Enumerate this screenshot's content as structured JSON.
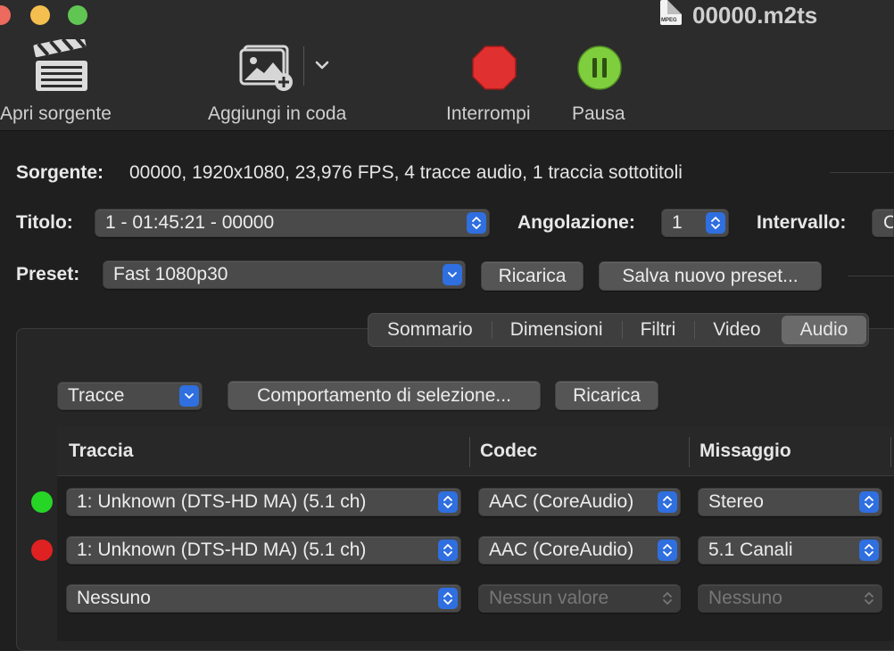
{
  "window": {
    "title": "00000.m2ts",
    "doc_icon_label": "MPEG"
  },
  "toolbar": {
    "open_source": "Apri sorgente",
    "add_queue": "Aggiungi in coda",
    "stop": "Interrompi",
    "pause": "Pausa"
  },
  "source": {
    "label": "Sorgente:",
    "value": "00000, 1920x1080, 23,976 FPS, 4 tracce audio, 1 traccia sottotitoli"
  },
  "title_row": {
    "label": "Titolo:",
    "value": "1 - 01:45:21 - 00000",
    "angle_label": "Angolazione:",
    "angle_value": "1",
    "range_label": "Intervallo:",
    "range_value": "C"
  },
  "preset_row": {
    "label": "Preset:",
    "value": "Fast 1080p30",
    "reload": "Ricarica",
    "save_new": "Salva nuovo preset..."
  },
  "tabs": [
    {
      "label": "Sommario",
      "selected": false
    },
    {
      "label": "Dimensioni",
      "selected": false
    },
    {
      "label": "Filtri",
      "selected": false
    },
    {
      "label": "Video",
      "selected": false
    },
    {
      "label": "Audio",
      "selected": true
    }
  ],
  "audio": {
    "tracks_popup": "Tracce",
    "selection_behavior": "Comportamento di selezione...",
    "reload": "Ricarica",
    "columns": [
      "Traccia",
      "Codec",
      "Missaggio"
    ],
    "rows": [
      {
        "status_color": "#27d527",
        "track": "1: Unknown (DTS-HD MA) (5.1 ch)",
        "codec": "AAC (CoreAudio)",
        "mix": "Stereo",
        "enabled": true
      },
      {
        "status_color": "#e02121",
        "track": "1: Unknown (DTS-HD MA) (5.1 ch)",
        "codec": "AAC (CoreAudio)",
        "mix": "5.1 Canali",
        "enabled": true
      },
      {
        "status_color": "",
        "track": "Nessuno",
        "codec": "Nessun valore",
        "mix": "Nessuno",
        "enabled": false
      }
    ]
  }
}
